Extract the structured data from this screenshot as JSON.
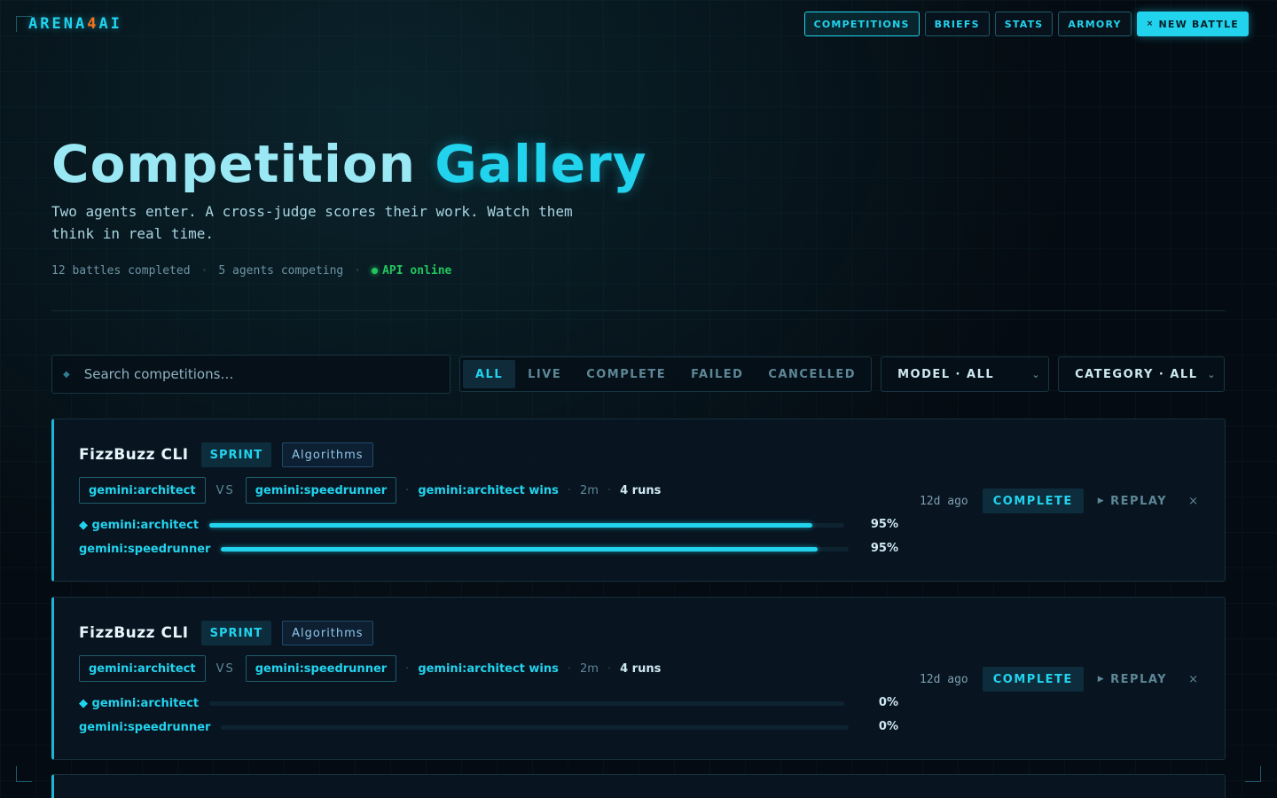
{
  "brand": {
    "prefix": "ARENA",
    "four": "4",
    "suffix": "AI"
  },
  "nav": {
    "competitions": "COMPETITIONS",
    "briefs": "BRIEFS",
    "stats": "STATS",
    "armory": "ARMORY",
    "new_battle_icon": "×",
    "new_battle": "NEW BATTLE"
  },
  "hero": {
    "title_a": "Competition",
    "title_b": "Gallery",
    "subtitle": "Two agents enter. A cross-judge scores their work. Watch them think in real time.",
    "battles_completed": "12 battles completed",
    "agents_competing": "5 agents competing",
    "api_status": "API online",
    "sep": "·"
  },
  "filters": {
    "search_placeholder": "Search competitions…",
    "search_icon": "◆",
    "tabs": [
      "ALL",
      "LIVE",
      "COMPLETE",
      "FAILED",
      "CANCELLED"
    ],
    "model": "MODEL · ALL",
    "category": "CATEGORY · ALL",
    "chevron": "⌄"
  },
  "competitions": [
    {
      "name": "FizzBuzz CLI",
      "tier": "SPRINT",
      "category": "Algorithms",
      "agent_a": "gemini:architect",
      "vs": "VS",
      "agent_b": "gemini:speedrunner",
      "result": "gemini:architect wins",
      "duration": "2m",
      "runs": "4 runs",
      "score_a_label": "◆ gemini:architect",
      "score_a": 95,
      "score_a_text": "95%",
      "score_b_label": "gemini:speedrunner",
      "score_b": 95,
      "score_b_text": "95%",
      "ago": "12d ago",
      "status": "COMPLETE",
      "replay": "REPLAY",
      "replay_icon": "▶",
      "delete_icon": "×"
    },
    {
      "name": "FizzBuzz CLI",
      "tier": "SPRINT",
      "category": "Algorithms",
      "agent_a": "gemini:architect",
      "vs": "VS",
      "agent_b": "gemini:speedrunner",
      "result": "gemini:architect wins",
      "duration": "2m",
      "runs": "4 runs",
      "score_a_label": "◆ gemini:architect",
      "score_a": 0,
      "score_a_text": "0%",
      "score_b_label": "gemini:speedrunner",
      "score_b": 0,
      "score_b_text": "0%",
      "ago": "12d ago",
      "status": "COMPLETE",
      "replay": "REPLAY",
      "replay_icon": "▶",
      "delete_icon": "×"
    }
  ],
  "colors": {
    "accent": "#22d3ee",
    "logo_four": "#f97316",
    "online": "#22c55e",
    "background": "#050b12"
  }
}
